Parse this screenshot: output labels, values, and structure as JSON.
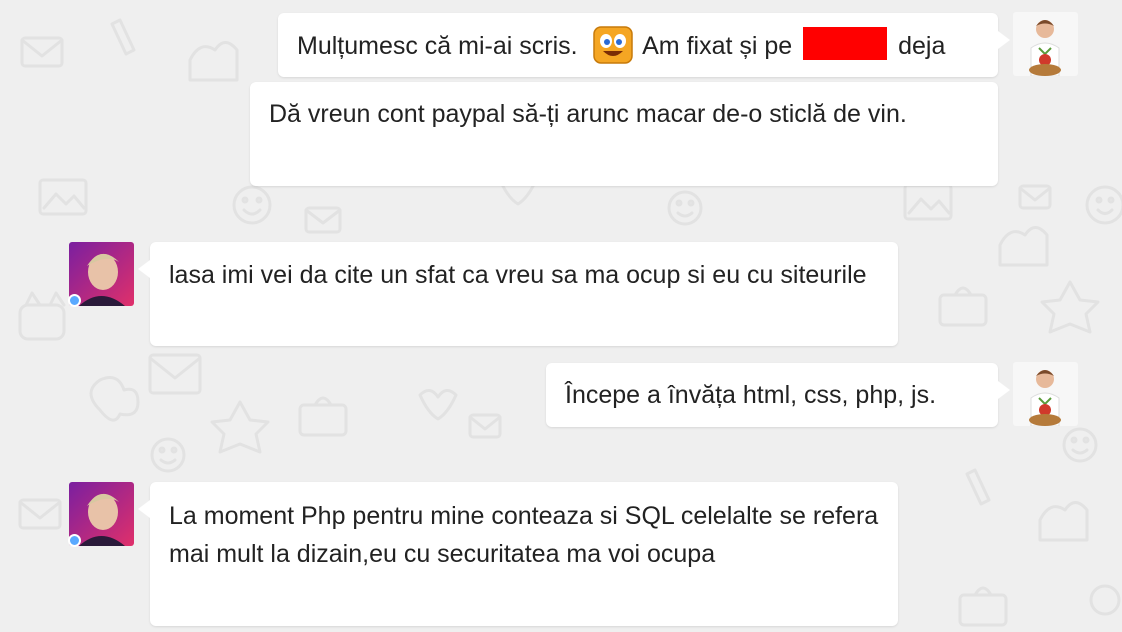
{
  "theme": {
    "wallpaper_color": "#efefef",
    "bubble_color": "#ffffff",
    "redaction_color": "#ff0000",
    "status_dot_color": "#5aa9ff"
  },
  "messages": [
    {
      "direction": "outgoing",
      "part1": "Mulțumesc că mi-ai scris.",
      "emoji": "laughing-smiley-icon",
      "part2": "Am fixat și pe",
      "part3": "deja"
    },
    {
      "direction": "outgoing",
      "text": "Dă vreun cont paypal să-ți arunc macar de-o sticlă de vin."
    },
    {
      "direction": "incoming",
      "text": "lasa imi vei da cite un sfat ca vreu sa ma ocup si eu cu siteurile"
    },
    {
      "direction": "outgoing",
      "text": "Începe a învăța html, css, php, js."
    },
    {
      "direction": "incoming",
      "text": "La moment Php pentru mine conteaza si SQL celelalte se refera mai mult la dizain,eu cu securitatea ma voi ocupa"
    }
  ]
}
